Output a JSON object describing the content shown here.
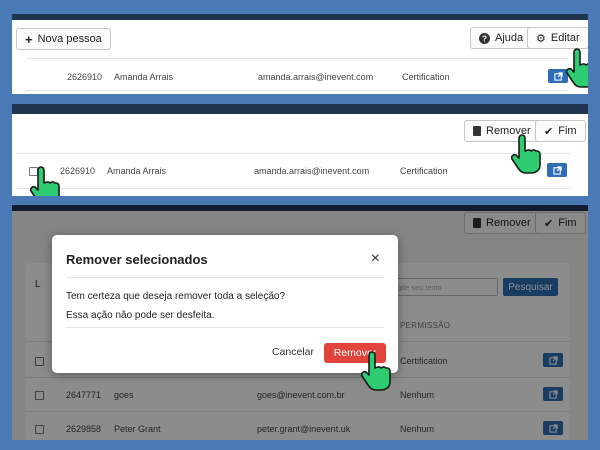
{
  "panel1": {
    "new_person_label": "Nova pessoa",
    "help_label": "Ajuda",
    "edit_label": "Editar",
    "row": {
      "id": "2626910",
      "name": "Amanda Arrais",
      "email": "amanda.arrais@inevent.com",
      "permission": "Certification"
    }
  },
  "panel2": {
    "remove_label": "Remover",
    "done_label": "Fim",
    "row": {
      "id": "2626910",
      "name": "Amanda Arrais",
      "email": "amanda.arrais@inevent.com",
      "permission": "Certification"
    }
  },
  "panel3": {
    "remove_label": "Remover",
    "done_label": "Fim",
    "search_placeholder": "Digite seu texto",
    "search_button": "Pesquisar",
    "column_permission": "PERMISSÃO",
    "list_fragment": "L",
    "rows": [
      {
        "id": "",
        "name": "",
        "email": "",
        "permission": "Certification"
      },
      {
        "id": "2647771",
        "name": "goes",
        "email": "goes@inevent.com.br",
        "permission": "Nenhum"
      },
      {
        "id": "2629858",
        "name": "Peter Grant",
        "email": "peter.grant@inevent.uk",
        "permission": "Nenhum"
      }
    ],
    "modal": {
      "title": "Remover selecionados",
      "close": "×",
      "line1": "Tem certeza que deseja remover toda a seleção?",
      "line2": "Essa ação não pode ser desfeita.",
      "cancel": "Cancelar",
      "confirm": "Remover"
    }
  },
  "colors": {
    "background": "#4a7ab5",
    "primary": "#2f6db5",
    "danger": "#e0443a",
    "hand": "#2ecc71"
  }
}
